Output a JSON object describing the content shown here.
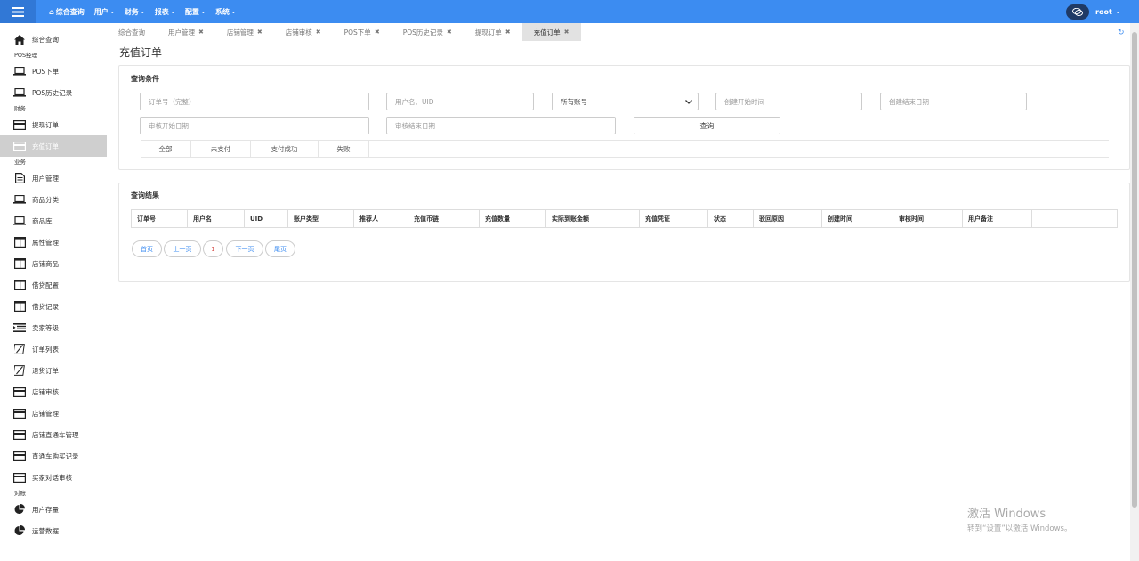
{
  "topbar": {
    "nav": [
      {
        "label": "综合查询",
        "has_caret": false
      },
      {
        "label": "用户",
        "has_caret": true
      },
      {
        "label": "财务",
        "has_caret": true
      },
      {
        "label": "报表",
        "has_caret": true
      },
      {
        "label": "配置",
        "has_caret": true
      },
      {
        "label": "系统",
        "has_caret": true
      }
    ],
    "user": "root",
    "caret": "⌄",
    "home_glyph": "⌂"
  },
  "sidebar": {
    "top_item": {
      "label": "综合查询",
      "icon": "home-icon"
    },
    "groups": [
      {
        "title": "POS经理",
        "items": [
          {
            "label": "POS下单",
            "icon": "laptop-icon"
          },
          {
            "label": "POS历史记录",
            "icon": "laptop-icon"
          }
        ]
      },
      {
        "title": "财务",
        "items": [
          {
            "label": "提现订单",
            "icon": "card-icon"
          },
          {
            "label": "充值订单",
            "icon": "card-icon",
            "active": true
          }
        ]
      },
      {
        "title": "业务",
        "items": [
          {
            "label": "用户管理",
            "icon": "document-icon"
          },
          {
            "label": "商品分类",
            "icon": "laptop-icon"
          },
          {
            "label": "商品库",
            "icon": "laptop-icon"
          },
          {
            "label": "属性管理",
            "icon": "columns-icon"
          },
          {
            "label": "店铺商品",
            "icon": "columns-icon"
          },
          {
            "label": "借贷配置",
            "icon": "columns-icon"
          },
          {
            "label": "借贷记录",
            "icon": "columns-icon"
          },
          {
            "label": "卖家等级",
            "icon": "list-icon"
          },
          {
            "label": "订单列表",
            "icon": "pen-icon"
          },
          {
            "label": "退货订单",
            "icon": "pen-icon"
          },
          {
            "label": "店铺审核",
            "icon": "card-icon"
          },
          {
            "label": "店铺管理",
            "icon": "card-icon"
          },
          {
            "label": "店铺直通车管理",
            "icon": "card-icon"
          },
          {
            "label": "直通车购买记录",
            "icon": "card-icon"
          },
          {
            "label": "买家对话审核",
            "icon": "card-icon"
          }
        ]
      },
      {
        "title": "对账",
        "items": [
          {
            "label": "用户存量",
            "icon": "pie-icon"
          },
          {
            "label": "运营数据",
            "icon": "pie-icon"
          }
        ]
      }
    ]
  },
  "tabs": [
    {
      "label": "综合查询",
      "closable": false
    },
    {
      "label": "用户管理",
      "closable": true
    },
    {
      "label": "店铺管理",
      "closable": true
    },
    {
      "label": "店铺审核",
      "closable": true
    },
    {
      "label": "POS下单",
      "closable": true
    },
    {
      "label": "POS历史记录",
      "closable": true
    },
    {
      "label": "提现订单",
      "closable": true
    },
    {
      "label": "充值订单",
      "closable": true,
      "active": true
    }
  ],
  "close_glyph": "✖",
  "refresh_glyph": "↻",
  "page_title": "充值订单",
  "query": {
    "title": "查询条件",
    "order_no_placeholder": "订单号（完整）",
    "user_placeholder": "用户名、UID",
    "account_select": "所有账号",
    "create_start_placeholder": "创建开始时间",
    "create_end_placeholder": "创建结束日期",
    "audit_start_placeholder": "审核开始日期",
    "audit_end_placeholder": "审核结束日期",
    "query_button": "查询",
    "status_tabs": [
      "全部",
      "未支付",
      "支付成功",
      "失败"
    ]
  },
  "results": {
    "title": "查询结果",
    "columns": [
      "订单号",
      "用户名",
      "UID",
      "账户类型",
      "推荐人",
      "充值币链",
      "充值数量",
      "实际到账金额",
      "充值凭证",
      "状态",
      "驳回原因",
      "创建时间",
      "审核时间",
      "用户备注",
      ""
    ],
    "pager": {
      "first": "首页",
      "prev": "上一页",
      "current": "1",
      "next": "下一页",
      "last": "尾页"
    }
  },
  "watermark": {
    "line1": "激活 Windows",
    "line2": "转到“设置”以激活 Windows。"
  },
  "colors": {
    "accent": "#3c8cf1",
    "active_bg": "#cfcfcf"
  }
}
